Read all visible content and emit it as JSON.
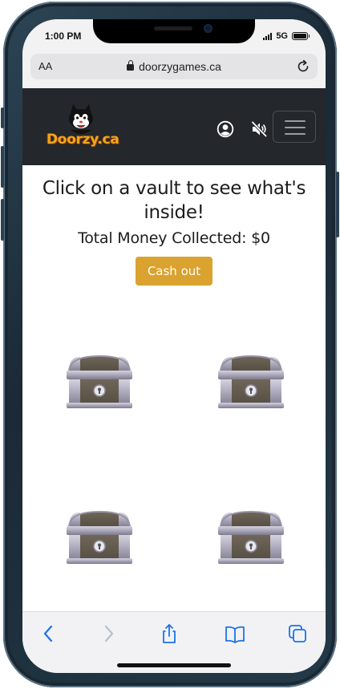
{
  "status_bar": {
    "time": "1:00 PM",
    "network": "5G"
  },
  "browser": {
    "text_size_label": "AA",
    "url": "doorzygames.ca"
  },
  "site": {
    "logo_text": "Doorzy.ca"
  },
  "game": {
    "headline": "Click on a vault to see what's inside!",
    "money_label": "Total Money Collected: $0",
    "cashout_label": "Cash out",
    "vault_count": 4
  },
  "colors": {
    "header_bg": "#24272b",
    "cashout_bg": "#daa22e",
    "logo_text": "#f4a51c",
    "toolbar_icon": "#1a73e8"
  },
  "toolbar": {
    "icons": [
      "back-icon",
      "forward-icon",
      "share-icon",
      "bookmarks-icon",
      "tabs-icon"
    ]
  }
}
